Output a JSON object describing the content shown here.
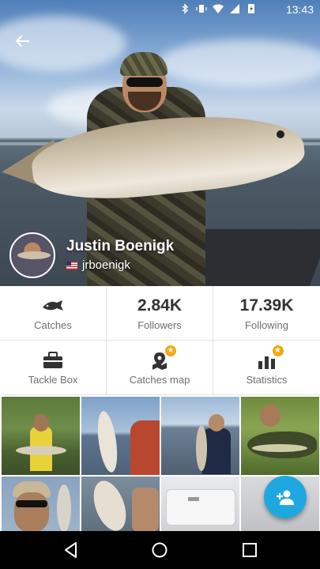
{
  "status_bar": {
    "time": "13:43"
  },
  "profile": {
    "name": "Justin Boenigk",
    "handle": "jrboenigk"
  },
  "stats": {
    "catches_label": "Catches",
    "followers_value": "2.84K",
    "followers_label": "Followers",
    "following_value": "17.39K",
    "following_label": "Following"
  },
  "menu": {
    "tackle_box": "Tackle Box",
    "catches_map": "Catches map",
    "statistics": "Statistics"
  },
  "icons": {
    "back": "arrow-back-icon",
    "catches": "fish-icon",
    "tackle_box": "toolbox-icon",
    "catches_map": "map-pin-icon",
    "statistics": "bar-chart-icon",
    "fab": "add-person-icon"
  },
  "colors": {
    "accent": "#1fa8e0",
    "premium_badge": "#f2a90f",
    "text_dark": "#333333",
    "text_muted": "#6f6f6f"
  }
}
